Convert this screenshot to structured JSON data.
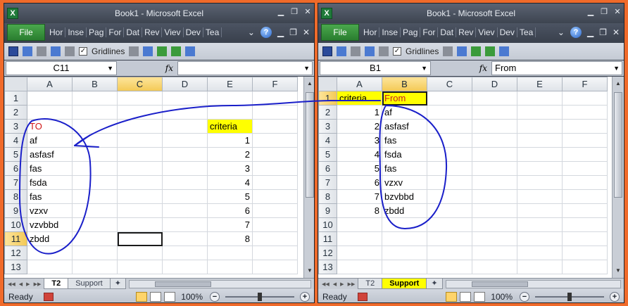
{
  "left": {
    "title": "Book1 - Microsoft Excel",
    "app_icon_letter": "X",
    "file_tab": "File",
    "ribbon_tabs": [
      "Hor",
      "Inse",
      "Pag",
      "For",
      "Dat",
      "Rev",
      "Viev",
      "Dev",
      "Tea"
    ],
    "gridlines_label": "Gridlines",
    "name_box": "C11",
    "fx": "fx",
    "formula": "",
    "columns": [
      "A",
      "B",
      "C",
      "D",
      "E",
      "F"
    ],
    "rows": [
      [
        "",
        "",
        "",
        "",
        "",
        ""
      ],
      [
        "",
        "",
        "",
        "",
        "",
        ""
      ],
      [
        "TO",
        "",
        "",
        "",
        "criteria",
        ""
      ],
      [
        "af",
        "",
        "",
        "",
        "1",
        ""
      ],
      [
        "asfasf",
        "",
        "",
        "",
        "2",
        ""
      ],
      [
        "fas",
        "",
        "",
        "",
        "3",
        ""
      ],
      [
        "fsda",
        "",
        "",
        "",
        "4",
        ""
      ],
      [
        "fas",
        "",
        "",
        "",
        "5",
        ""
      ],
      [
        "vzxv",
        "",
        "",
        "",
        "6",
        ""
      ],
      [
        "vzvbbd",
        "",
        "",
        "",
        "7",
        ""
      ],
      [
        "zbdd",
        "",
        "",
        "",
        "8",
        ""
      ],
      [
        "",
        "",
        "",
        "",
        "",
        ""
      ],
      [
        "",
        "",
        "",
        "",
        "",
        ""
      ]
    ],
    "sheet_tabs": [
      "T2",
      "Support"
    ],
    "active_tab": "T2",
    "status": "Ready",
    "zoom": "100%"
  },
  "right": {
    "title": "Book1 - Microsoft Excel",
    "app_icon_letter": "X",
    "file_tab": "File",
    "ribbon_tabs": [
      "Hor",
      "Inse",
      "Pag",
      "For",
      "Dat",
      "Rev",
      "Viev",
      "Dev",
      "Tea"
    ],
    "gridlines_label": "Gridlines",
    "name_box": "B1",
    "fx": "fx",
    "formula": "From",
    "columns": [
      "A",
      "B",
      "C",
      "D",
      "E",
      "F"
    ],
    "rows": [
      [
        "criteria",
        "From",
        "",
        "",
        "",
        ""
      ],
      [
        "1",
        "af",
        "",
        "",
        "",
        ""
      ],
      [
        "2",
        "asfasf",
        "",
        "",
        "",
        ""
      ],
      [
        "3",
        "fas",
        "",
        "",
        "",
        ""
      ],
      [
        "4",
        "fsda",
        "",
        "",
        "",
        ""
      ],
      [
        "5",
        "fas",
        "",
        "",
        "",
        ""
      ],
      [
        "6",
        "vzxv",
        "",
        "",
        "",
        ""
      ],
      [
        "7",
        "bzvbbd",
        "",
        "",
        "",
        ""
      ],
      [
        "8",
        "zbdd",
        "",
        "",
        "",
        ""
      ],
      [
        "",
        "",
        "",
        "",
        "",
        ""
      ],
      [
        "",
        "",
        "",
        "",
        "",
        ""
      ],
      [
        "",
        "",
        "",
        "",
        "",
        ""
      ],
      [
        "",
        "",
        "",
        "",
        "",
        ""
      ]
    ],
    "sheet_tabs": [
      "T2",
      "Support"
    ],
    "active_tab": "Support",
    "status": "Ready",
    "zoom": "100%"
  },
  "colors": {
    "highlight": "#ffff00",
    "header_red": "#d01818",
    "annotation_ink": "#1a1fc9",
    "frame": "#f06a2a"
  },
  "icons": [
    "excel-app-icon",
    "help-icon",
    "minimize-icon",
    "restore-icon",
    "close-icon",
    "save-icon",
    "undo-icon",
    "redo-icon",
    "gridlines-checkbox",
    "fx-icon",
    "new-sheet-icon",
    "macro-record-icon",
    "normal-view-icon",
    "page-layout-icon",
    "page-break-icon",
    "zoom-out-icon",
    "zoom-in-icon"
  ]
}
